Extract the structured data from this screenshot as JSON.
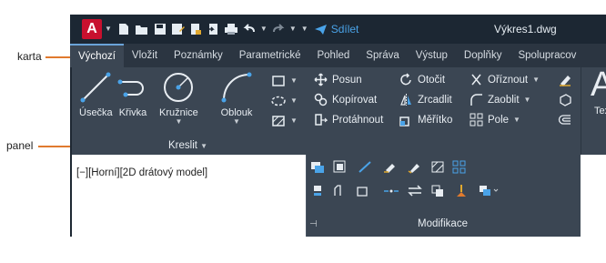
{
  "annotations": {
    "tab_callout": "karta",
    "panel_callout": "panel"
  },
  "titlebar": {
    "logo_letter": "A",
    "share_label": "Sdílet",
    "document_title": "Výkres1.dwg"
  },
  "tabs": [
    {
      "label": "Výchozí",
      "active": true
    },
    {
      "label": "Vložit"
    },
    {
      "label": "Poznámky"
    },
    {
      "label": "Parametrické"
    },
    {
      "label": "Pohled"
    },
    {
      "label": "Správa"
    },
    {
      "label": "Výstup"
    },
    {
      "label": "Doplňky"
    },
    {
      "label": "Spolupracov"
    }
  ],
  "ribbon": {
    "draw_panel": {
      "title": "Kreslit",
      "tools": [
        "Úsečka",
        "Křivka",
        "Kružnice",
        "Oblouk"
      ]
    },
    "modify_panel": {
      "title": "Modifikace",
      "col1": [
        "Posun",
        "Kopírovat",
        "Protáhnout"
      ],
      "col2": [
        "Otočit",
        "Zrcadlit",
        "Měřítko"
      ],
      "col3": [
        "Oříznout",
        "Zaoblit",
        "Pole"
      ]
    },
    "annotation_partial": {
      "letter": "A",
      "label": "Tex"
    }
  },
  "viewport": {
    "label": "[−][Horní][2D drátový model]"
  },
  "colors": {
    "titlebar": "#1c2733",
    "ribbon": "#3b4653",
    "accent_red": "#c8102e",
    "share_blue": "#4aa3e8",
    "callout_orange": "#e07a2e"
  }
}
